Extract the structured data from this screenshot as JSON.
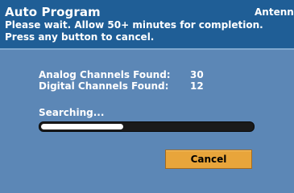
{
  "dialog": {
    "title": "Auto Program",
    "source": "Antenna",
    "instructions": [
      "Please wait. Allow 50+ minutes for completion.",
      "Press any button to cancel."
    ]
  },
  "results": {
    "analog_label": "Analog Channels Found:",
    "analog_value": "30",
    "digital_label": "Digital Channels Found:",
    "digital_value": "12"
  },
  "progress": {
    "status": "Searching...",
    "fraction": 0.39
  },
  "actions": {
    "cancel_label": "Cancel"
  },
  "colors": {
    "header_bg": "#1f5e96",
    "body_bg": "#5c87b6",
    "button_bg": "#e8a53b",
    "progress_track": "#1a1a1a",
    "progress_fill": "#ffffff"
  }
}
